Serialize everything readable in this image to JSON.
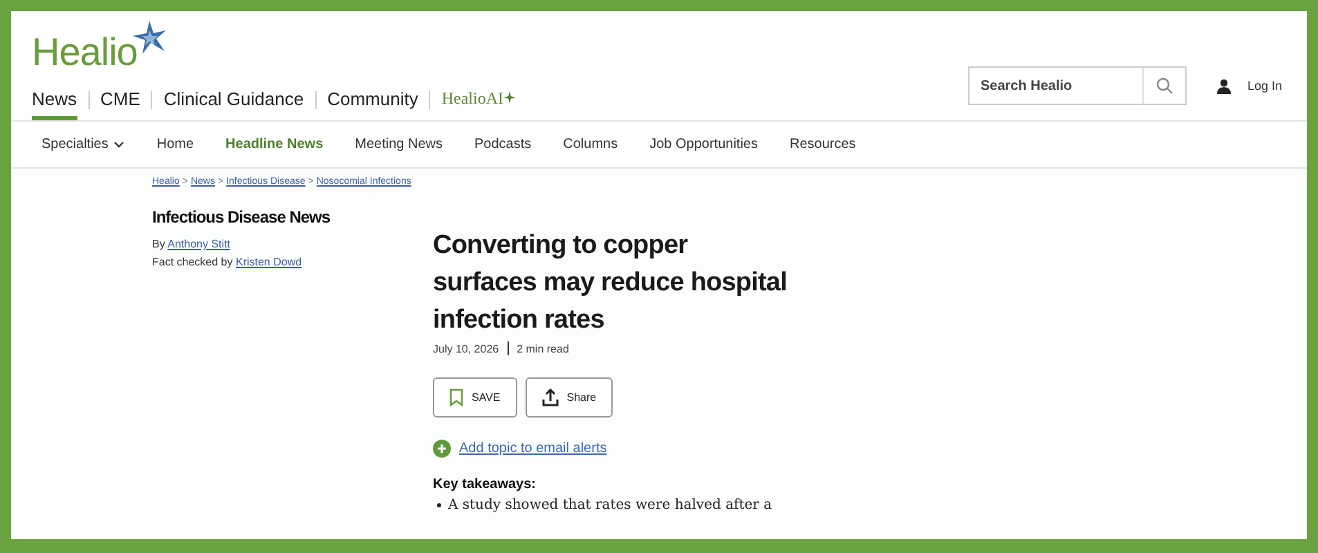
{
  "logo": {
    "text": "Healio"
  },
  "top_nav": [
    {
      "label": "News",
      "selected": true
    },
    {
      "label": "CME",
      "selected": false
    },
    {
      "label": "Clinical Guidance",
      "selected": false
    },
    {
      "label": "Community",
      "selected": false
    },
    {
      "label": "HealioAI",
      "selected": false,
      "kind": "ai"
    }
  ],
  "search": {
    "placeholder": "Search Healio"
  },
  "login": {
    "label": "Log In"
  },
  "sub_nav": [
    {
      "label": "Specialties",
      "selected": false,
      "kind": "dropdown"
    },
    {
      "label": "Home",
      "selected": false
    },
    {
      "label": "Headline News",
      "selected": true
    },
    {
      "label": "Meeting News",
      "selected": false
    },
    {
      "label": "Podcasts",
      "selected": false
    },
    {
      "label": "Columns",
      "selected": false
    },
    {
      "label": "Job Opportunities",
      "selected": false
    },
    {
      "label": "Resources",
      "selected": false
    }
  ],
  "breadcrumb": [
    "Healio",
    "News",
    "Infectious Disease",
    "Nosocomial Infections"
  ],
  "breadcrumb_separator": ">",
  "section": "Infectious Disease News",
  "byline": {
    "prefix": "By",
    "author": "Anthony Stitt"
  },
  "fact_check": {
    "prefix": "Fact checked by",
    "name": "Kristen Dowd"
  },
  "headline": "Converting to copper surfaces may reduce hospital infection rates",
  "date": "July 10, 2026",
  "read_time": "2 min read",
  "actions": [
    {
      "label": "SAVE",
      "kind": "save"
    },
    {
      "label": "Share",
      "kind": "share"
    }
  ],
  "alert_link": "Add topic to email alerts",
  "takeaways": {
    "title": "Key takeaways:",
    "items": [
      "A study showed that rates were halved after a"
    ]
  }
}
